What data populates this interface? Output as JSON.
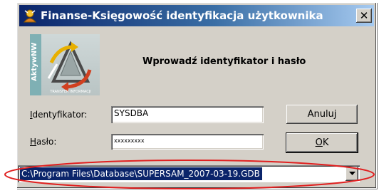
{
  "window": {
    "title": "Finanse-Księgowość identyfikacja użytkownika",
    "close_glyph": "✕"
  },
  "logo": {
    "side_text": "AktywNW",
    "bottom_text": "TRANSFER INFORMACJI"
  },
  "header": {
    "heading": "Wprowadź identyfikator i hasło"
  },
  "form": {
    "identifier_label_key": "I",
    "identifier_label_rest": "dentyfikator:",
    "identifier_value": "SYSDBA",
    "password_label_key": "H",
    "password_label_rest": "asło:",
    "password_value": "xxxxxxxxx"
  },
  "buttons": {
    "cancel_label": "Anuluj",
    "ok_label_key": "O",
    "ok_label_rest": "K"
  },
  "database": {
    "selected_path": "C:\\Program Files\\Database\\SUPERSAM_2007-03-19.GDB"
  },
  "colors": {
    "annotation_ellipse": "#e02020",
    "titlebar_start": "#0a246a",
    "titlebar_end": "#a6caf0",
    "selection": "#0a246a"
  },
  "icons": {
    "title": "user-key-icon",
    "logo": "triangle-arrows-logo",
    "dropdown": "chevron-down-icon"
  }
}
